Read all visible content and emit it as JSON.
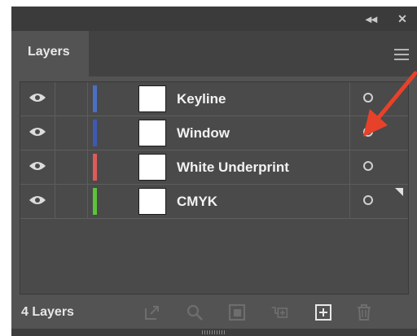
{
  "panel": {
    "collapse_icon": "double-chevron-left-icon",
    "close_icon": "close-icon",
    "collapse_glyph": "◂◂",
    "close_glyph": "✕"
  },
  "tab": {
    "label": "Layers",
    "menu_icon": "hamburger-menu-icon"
  },
  "layers": [
    {
      "name": "Keyline",
      "color": "#4a6fc4",
      "visible": true,
      "target_icon": "target-circle-icon"
    },
    {
      "name": "Window",
      "color": "#3f59b3",
      "visible": true,
      "target_icon": "target-circle-icon"
    },
    {
      "name": "White Underprint",
      "color": "#e05a5a",
      "visible": true,
      "target_icon": "target-circle-icon"
    },
    {
      "name": "CMYK",
      "color": "#5cc43b",
      "visible": true,
      "target_icon": "target-circle-icon",
      "selected_corner": true
    }
  ],
  "footer": {
    "count_label": "4 Layers",
    "icons": [
      "export-icon",
      "locate-object-icon",
      "make-clipping-mask-icon",
      "create-sublayer-icon",
      "new-layer-icon",
      "delete-icon"
    ]
  },
  "annotation": {
    "arrow_color": "#e8412a"
  }
}
